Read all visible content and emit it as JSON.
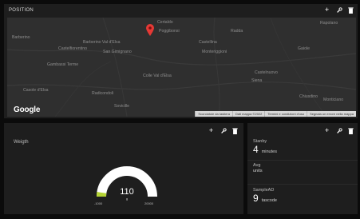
{
  "map_panel": {
    "title": "POSITION",
    "places": [
      "Certaldo",
      "Poggibonsi",
      "Barberino",
      "Castelfiorentino",
      "Barberino Val d'Elsa",
      "Radda",
      "Gambassi Terme",
      "Castellina",
      "San Gimignano",
      "Colle Val d'Elsa",
      "Gaiole",
      "Casole d'Elsa",
      "Monteriggioni",
      "Castelnuovo",
      "Radicondoli",
      "Siena",
      "Sovicille",
      "Chiusdino",
      "Monticiano",
      "Rapolano"
    ],
    "google_logo": "Google",
    "attributions": [
      "Scorciatoie da tastiera",
      "Dati mappa ©2022",
      "Termini e condizioni d'uso",
      "Segnala un errore nella mappa"
    ]
  },
  "gauge_panel": {
    "title": "Weigth",
    "gauge": {
      "value": "110",
      "unit": "g",
      "min": "-1000",
      "max": "20000",
      "fraction": 0.05
    }
  },
  "stats_panel": {
    "items": [
      {
        "label": "Stanby",
        "value": "4",
        "unit": "minutes"
      },
      {
        "label": "Avg",
        "value": "",
        "unit": "units"
      },
      {
        "label": "SampleAD",
        "value": "9",
        "unit": "tascode"
      }
    ]
  },
  "colors": {
    "page_bg": "#0b0b0b",
    "panel_bg": "#1e1e1e",
    "map_bg": "#2f2f2f",
    "gauge_fill": "#b5d434",
    "gauge_track": "#ffffff",
    "pin": "#e53935"
  },
  "icons": [
    "plus-icon",
    "wrench-icon",
    "trash-icon",
    "map-pin-icon"
  ]
}
